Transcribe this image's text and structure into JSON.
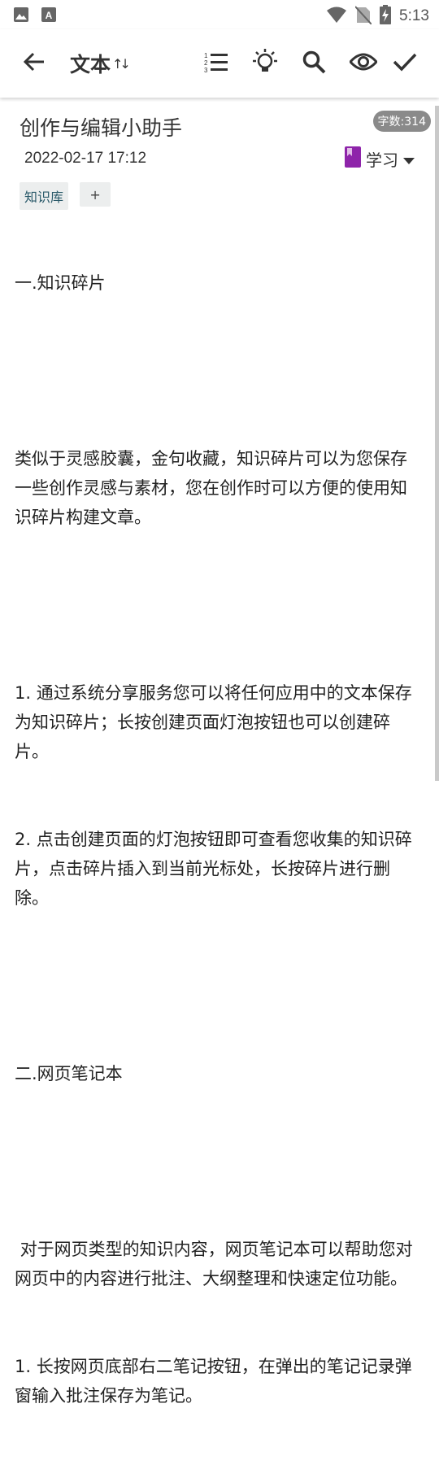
{
  "status_bar": {
    "time": "5:13",
    "left_icons": [
      "image-icon",
      "app-notification-icon"
    ],
    "right_icons": [
      "wifi-icon",
      "no-sim-icon",
      "battery-charging-icon"
    ]
  },
  "toolbar": {
    "title": "文本",
    "title_sort_glyph": "↑↓",
    "icons": [
      "back-arrow-icon",
      "list-icon",
      "lightbulb-icon",
      "search-icon",
      "eye-icon",
      "check-icon"
    ]
  },
  "document": {
    "title": "创作与编辑小助手",
    "word_count": "字数:314",
    "date": "2022-02-17 17:12",
    "category": "学习",
    "category_color": "#8e24aa",
    "tags": [
      "知识库"
    ],
    "add_tag_label": "+",
    "body": [
      "一.知识碎片",
      "",
      "类似于灵感胶囊，金句收藏，知识碎片可以为您保存一些创作灵感与素材，您在创作时可以方便的使用知识碎片构建文章。",
      "",
      "1. 通过系统分享服务您可以将任何应用中的文本保存为知识碎片；长按创建页面灯泡按钮也可以创建碎片。",
      "2. 点击创建页面的灯泡按钮即可查看您收集的知识碎片，点击碎片插入到当前光标处，长按碎片进行删除。",
      "",
      "二.网页笔记本",
      "",
      " 对于网页类型的知识内容，网页笔记本可以帮助您对网页中的内容进行批注、大纲整理和快速定位功能。",
      "1. 长按网页底部右二笔记按钮，在弹出的笔记记录弹窗输入批注保存为笔记。"
    ]
  }
}
